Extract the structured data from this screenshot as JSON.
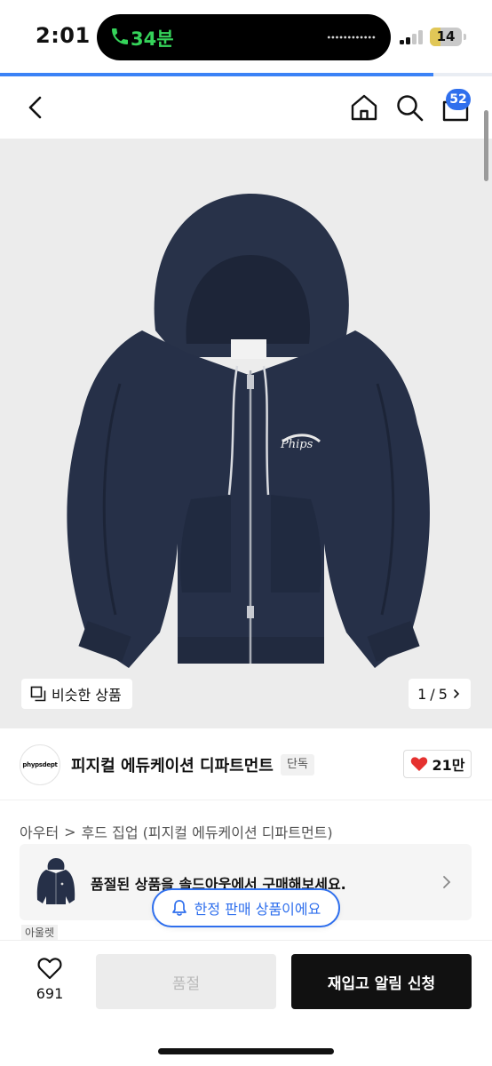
{
  "status_bar": {
    "time": "2:01",
    "call_duration": "34분",
    "battery": "14"
  },
  "page_progress": 0.88,
  "header": {
    "cart_count": "52"
  },
  "gallery": {
    "similar_label": "비슷한 상품",
    "page_current": "1",
    "page_total": "5",
    "page_separator": "/"
  },
  "brand": {
    "logo_text": "phypsdept",
    "name": "피지컬 에듀케이션 디파트먼트",
    "tag": "단독",
    "likes": "21만"
  },
  "category": {
    "parent": "아우터",
    "separator": ">",
    "child": "후드 집업 (피지컬 에듀케이션 디파트먼트)"
  },
  "soldout_banner": {
    "text": "품절된 상품을 솔드아웃에서 구매해보세요."
  },
  "limited": {
    "text": "한정 판매 상품이에요"
  },
  "outlet_tag": "아울렛",
  "bottom_bar": {
    "wish_count": "691",
    "soldout_label": "품절",
    "restock_label": "재입고 알림 신청"
  },
  "colors": {
    "accent": "#2f6fed",
    "heart": "#e5312f",
    "call_green": "#35d35a",
    "hoodie_navy": "#26304a"
  }
}
